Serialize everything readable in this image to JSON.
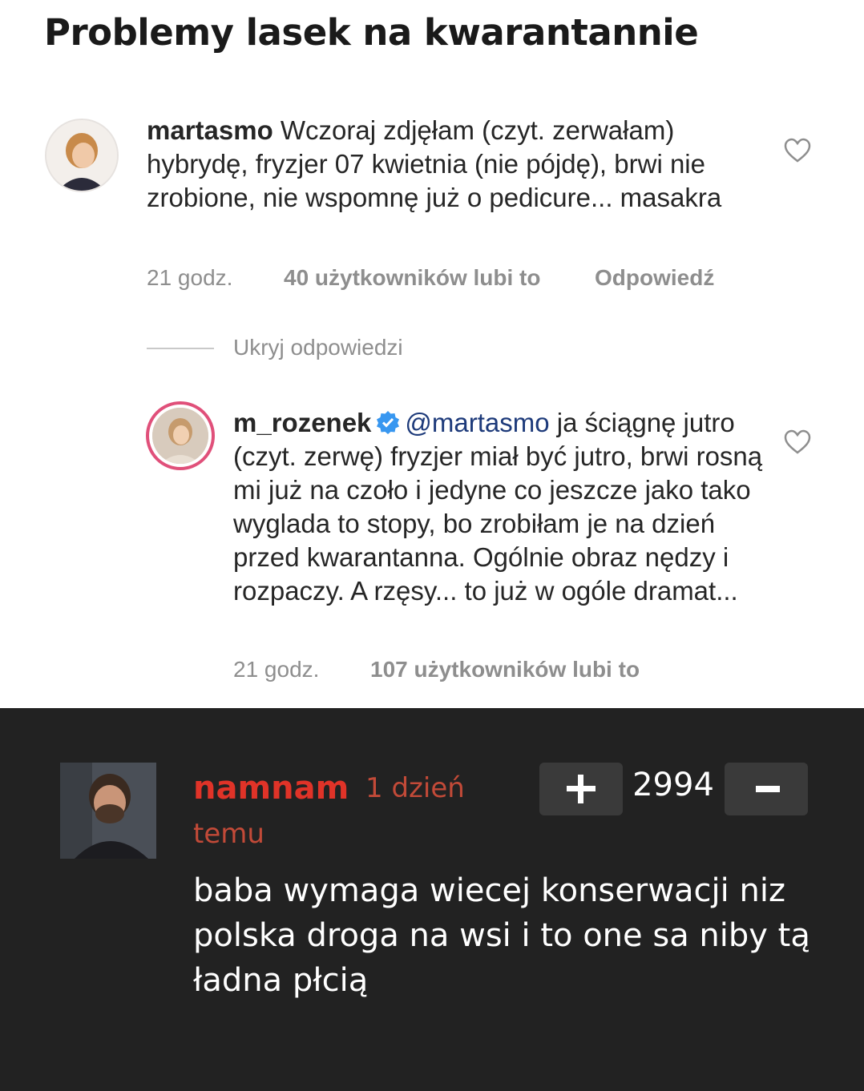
{
  "post": {
    "title": "Problemy lasek na kwarantannie"
  },
  "comment1": {
    "username": "martasmo",
    "text": "Wczoraj zdjęłam (czyt. zerwałam) hybrydę, fryzjer 07 kwietnia (nie pójdę), brwi nie zrobione, nie wspomnę już o pedicure... masakra",
    "time": "21 godz.",
    "likes": "40 użytkowników lubi to",
    "reply": "Odpowiedź"
  },
  "hide_replies": "Ukryj odpowiedzi",
  "reply1": {
    "username": "m_rozenek",
    "mention": "@martasmo",
    "text": "ja ściągnę jutro (czyt. zerwę) fryzjer miał być jutro, brwi rosną mi już na czoło i jedyne co jeszcze jako tako wyglada to stopy, bo zrobiłam je na dzień przed kwarantanna. Ogólnie obraz nędzy i rozpaczy. A rzęsy... to już w ogóle dramat...",
    "time": "21 godz.",
    "likes": "107 użytkowników lubi to"
  },
  "site_comment": {
    "author": "namnam",
    "age_part1": "1 dzień",
    "age_part2": "temu",
    "score": "2994",
    "text": "baba wymaga wiecej konserwacji niz polska droga na wsi i to one sa niby tą ładna płcią"
  },
  "icons": {
    "like1": "heart-outline-icon",
    "like2": "heart-outline-icon",
    "verified": "verified-badge-icon",
    "upvote": "plus-icon",
    "downvote": "minus-icon"
  },
  "colors": {
    "author": "#e03328",
    "age": "#c24a38",
    "dark_bg": "#222222",
    "button_bg": "#3a3a3a",
    "verified": "#3897f0"
  }
}
